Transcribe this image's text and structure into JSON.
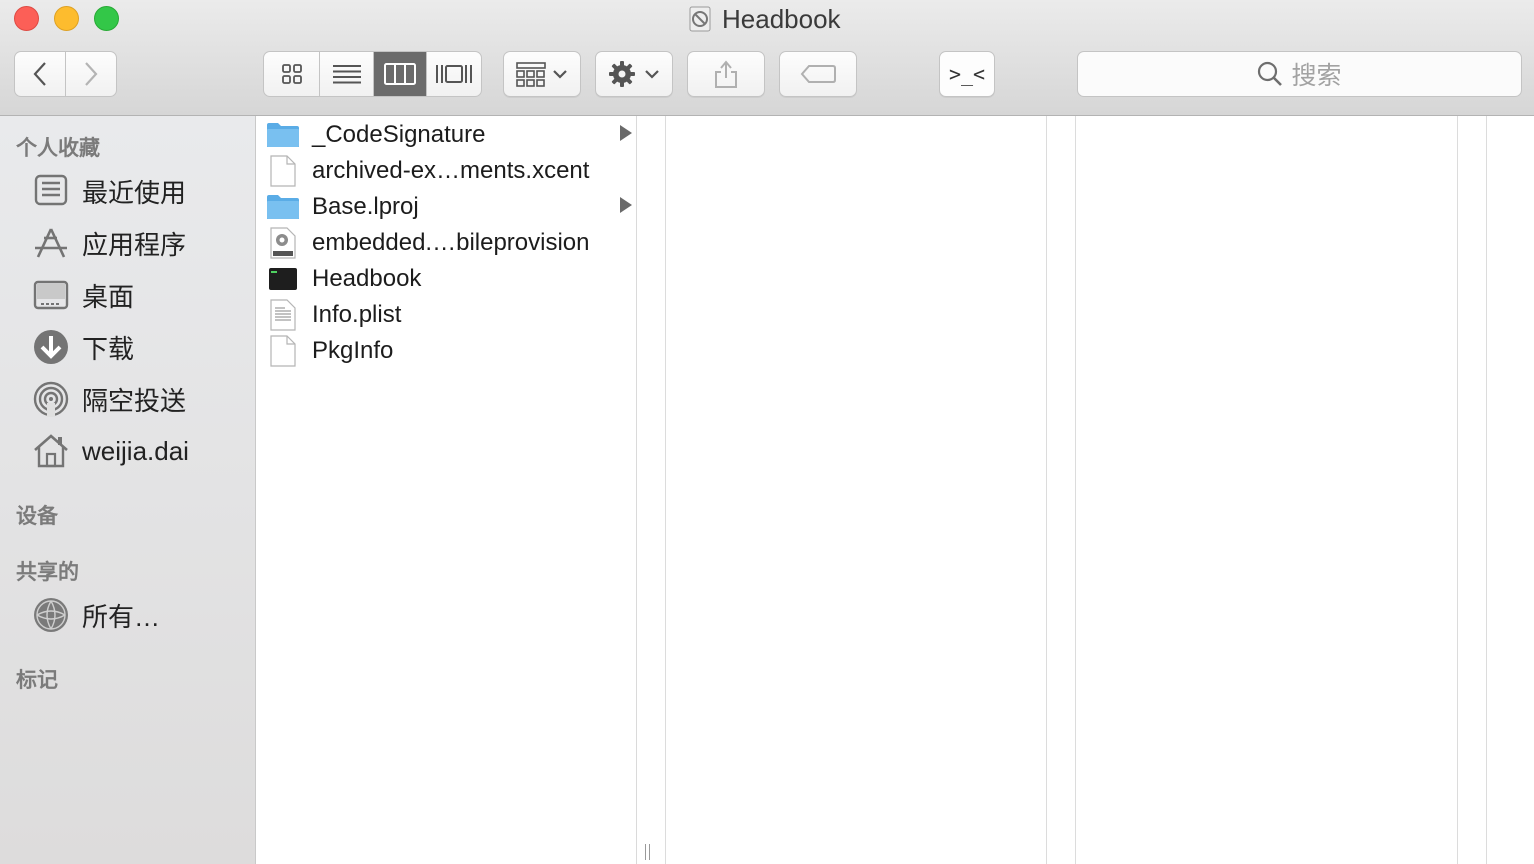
{
  "window": {
    "title": "Headbook"
  },
  "toolbar": {
    "search_placeholder": "搜索",
    "terminal_label": ">_<"
  },
  "sidebar": {
    "favorites_heading": "个人收藏",
    "favorites": [
      {
        "label": "最近使用",
        "icon": "recents-icon"
      },
      {
        "label": "应用程序",
        "icon": "applications-icon"
      },
      {
        "label": "桌面",
        "icon": "desktop-icon"
      },
      {
        "label": "下载",
        "icon": "downloads-icon"
      },
      {
        "label": "隔空投送",
        "icon": "airdrop-icon"
      },
      {
        "label": "weijia.dai",
        "icon": "home-icon"
      }
    ],
    "devices_heading": "设备",
    "shared_heading": "共享的",
    "shared": [
      {
        "label": "所有…",
        "icon": "network-icon"
      }
    ],
    "tags_heading": "标记"
  },
  "files": [
    {
      "name": "_CodeSignature",
      "type": "folder",
      "has_children": true
    },
    {
      "name": "archived-ex…ments.xcent",
      "type": "document",
      "has_children": false
    },
    {
      "name": "Base.lproj",
      "type": "folder",
      "has_children": true
    },
    {
      "name": "embedded.…bileprovision",
      "type": "provision",
      "has_children": false
    },
    {
      "name": "Headbook",
      "type": "executable",
      "has_children": false
    },
    {
      "name": "Info.plist",
      "type": "plist",
      "has_children": false
    },
    {
      "name": "PkgInfo",
      "type": "document",
      "has_children": false
    }
  ],
  "colors": {
    "folder": "#6cb6ea",
    "active_view": "#6b6b6b",
    "close": "#fc5f57",
    "minimize": "#fdbc2e",
    "maximize": "#33c748"
  }
}
